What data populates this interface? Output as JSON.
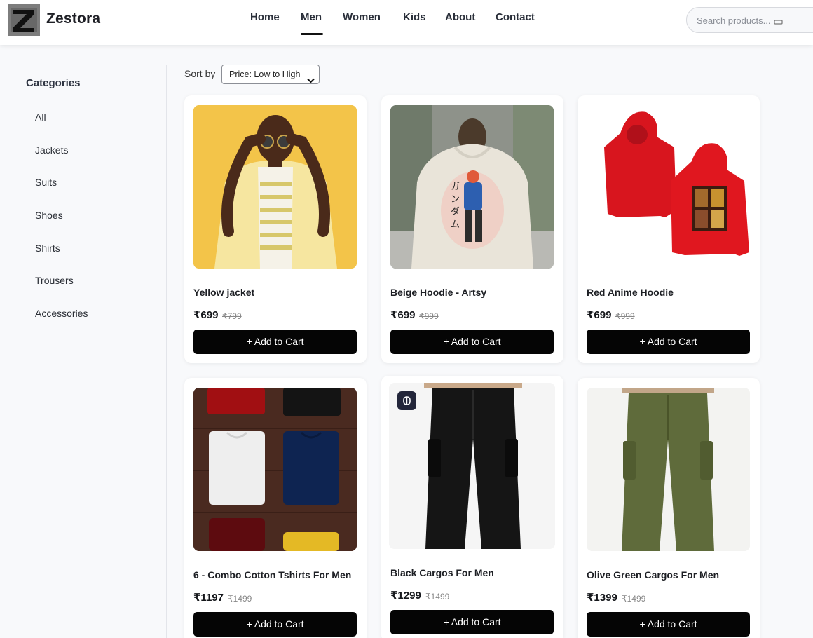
{
  "header": {
    "brand": "Zestora",
    "logo_letter": "Z",
    "nav": [
      "Home",
      "Men",
      "Women",
      "Kids",
      "About",
      "Contact"
    ],
    "active_nav": "Men",
    "search_placeholder": "Search products..."
  },
  "sidebar": {
    "title": "Categories",
    "items": [
      "All",
      "Jackets",
      "Suits",
      "Shoes",
      "Shirts",
      "Trousers",
      "Accessories"
    ]
  },
  "sort": {
    "label": "Sort by",
    "selected": "Price: Low to High"
  },
  "products": [
    {
      "name": "Yellow jacket",
      "price": "₹699",
      "old_price": "₹799",
      "button": "+ Add to Cart",
      "image": "yellow-jacket-man"
    },
    {
      "name": "Beige Hoodie - Artsy",
      "price": "₹699",
      "old_price": "₹999",
      "button": "+ Add to Cart",
      "image": "beige-hoodie-back-print"
    },
    {
      "name": "Red Anime Hoodie",
      "price": "₹699",
      "old_price": "₹999",
      "button": "+ Add to Cart",
      "image": "red-hoodie-front-back"
    },
    {
      "name": "6 - Combo Cotton Tshirts For Men",
      "price": "₹1197",
      "old_price": "₹1499",
      "button": "+ Add to Cart",
      "image": "folded-tshirts"
    },
    {
      "name": "Black Cargos For Men",
      "price": "₹1299",
      "old_price": "₹1499",
      "button": "+ Add to Cart",
      "image": "black-cargo-pants"
    },
    {
      "name": "Olive Green Cargos For Men",
      "price": "₹1399",
      "old_price": "₹1499",
      "button": "+ Add to Cart",
      "image": "olive-cargo-pants"
    }
  ],
  "colors": {
    "button_bg": "#050505",
    "page_bg": "#f8f9fb",
    "badge_bg": "#23263a"
  }
}
